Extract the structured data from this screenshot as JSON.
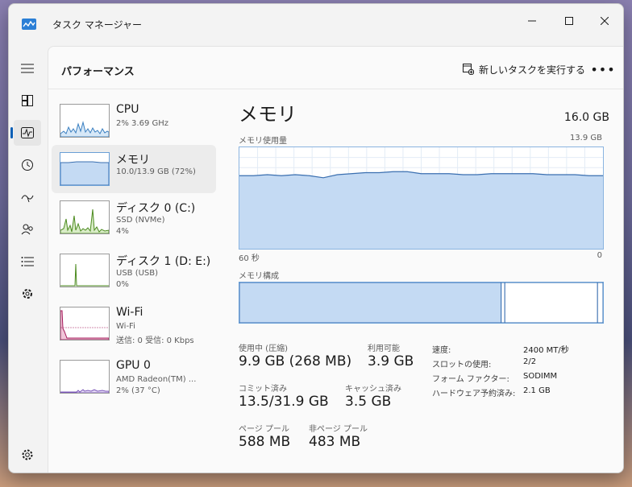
{
  "window": {
    "title": "タスク マネージャー"
  },
  "header": {
    "title": "パフォーマンス",
    "run_task_label": "新しいタスクを実行する",
    "more_label": "•••"
  },
  "nav": {
    "items": [
      {
        "name": "hamburger-menu-icon"
      },
      {
        "name": "processes-icon"
      },
      {
        "name": "performance-icon",
        "active": true
      },
      {
        "name": "app-history-icon"
      },
      {
        "name": "startup-apps-icon"
      },
      {
        "name": "users-icon"
      },
      {
        "name": "details-icon"
      },
      {
        "name": "services-icon"
      }
    ],
    "settings": "settings-icon"
  },
  "devices": [
    {
      "title": "CPU",
      "sub1": "2% 3.69 GHz",
      "sub2": "",
      "sub3": ""
    },
    {
      "title": "メモリ",
      "sub1": "10.0/13.9 GB (72%)",
      "sub2": "",
      "sub3": ""
    },
    {
      "title": "ディスク 0 (C:)",
      "sub1": "SSD (NVMe)",
      "sub2": "4%",
      "sub3": ""
    },
    {
      "title": "ディスク 1 (D: E:)",
      "sub1": "USB (USB)",
      "sub2": "0%",
      "sub3": ""
    },
    {
      "title": "Wi-Fi",
      "sub1": "Wi-Fi",
      "sub2": "送信: 0 受信: 0 Kbps",
      "sub3": ""
    },
    {
      "title": "GPU 0",
      "sub1": "AMD Radeon(TM) ...",
      "sub2": "2% (37 °C)",
      "sub3": ""
    }
  ],
  "colors": {
    "cpu": "#3a7fc1",
    "memory": "#3a6fb0",
    "disk": "#4b8a1e",
    "wifi": "#a4185a",
    "gpu": "#7a55b8",
    "memory_fill": "#c4daf3"
  },
  "memory": {
    "title": "メモリ",
    "total": "16.0 GB",
    "usage_label": "メモリ使用量",
    "usage_max": "13.9 GB",
    "axis_left": "60 秒",
    "axis_right": "0",
    "composition_label": "メモリ構成",
    "usage_fraction": 0.72,
    "usage_series": [
      0.72,
      0.72,
      0.73,
      0.72,
      0.73,
      0.72,
      0.7,
      0.73,
      0.74,
      0.75,
      0.75,
      0.76,
      0.76,
      0.74,
      0.74,
      0.74,
      0.73,
      0.73,
      0.74,
      0.74,
      0.74,
      0.74,
      0.73,
      0.73,
      0.73,
      0.72,
      0.72
    ],
    "composition": {
      "in_use": 0.72,
      "modified": 0.01,
      "standby": 0.255,
      "free": 0.015
    },
    "stats": {
      "in_use_label": "使用中 (圧縮)",
      "in_use_value": "9.9 GB (268 MB)",
      "available_label": "利用可能",
      "available_value": "3.9 GB",
      "committed_label": "コミット済み",
      "committed_value": "13.5/31.9 GB",
      "cached_label": "キャッシュ済み",
      "cached_value": "3.5 GB",
      "paged_label": "ページ プール",
      "paged_value": "588 MB",
      "nonpaged_label": "非ページ プール",
      "nonpaged_value": "483 MB"
    },
    "specs": [
      {
        "key": "速度:",
        "value": "2400 MT/秒"
      },
      {
        "key": "スロットの使用:",
        "value": "2/2"
      },
      {
        "key": "フォーム ファクター:",
        "value": "SODIMM"
      },
      {
        "key": "ハードウェア予約済み:",
        "value": "2.1 GB"
      }
    ]
  }
}
